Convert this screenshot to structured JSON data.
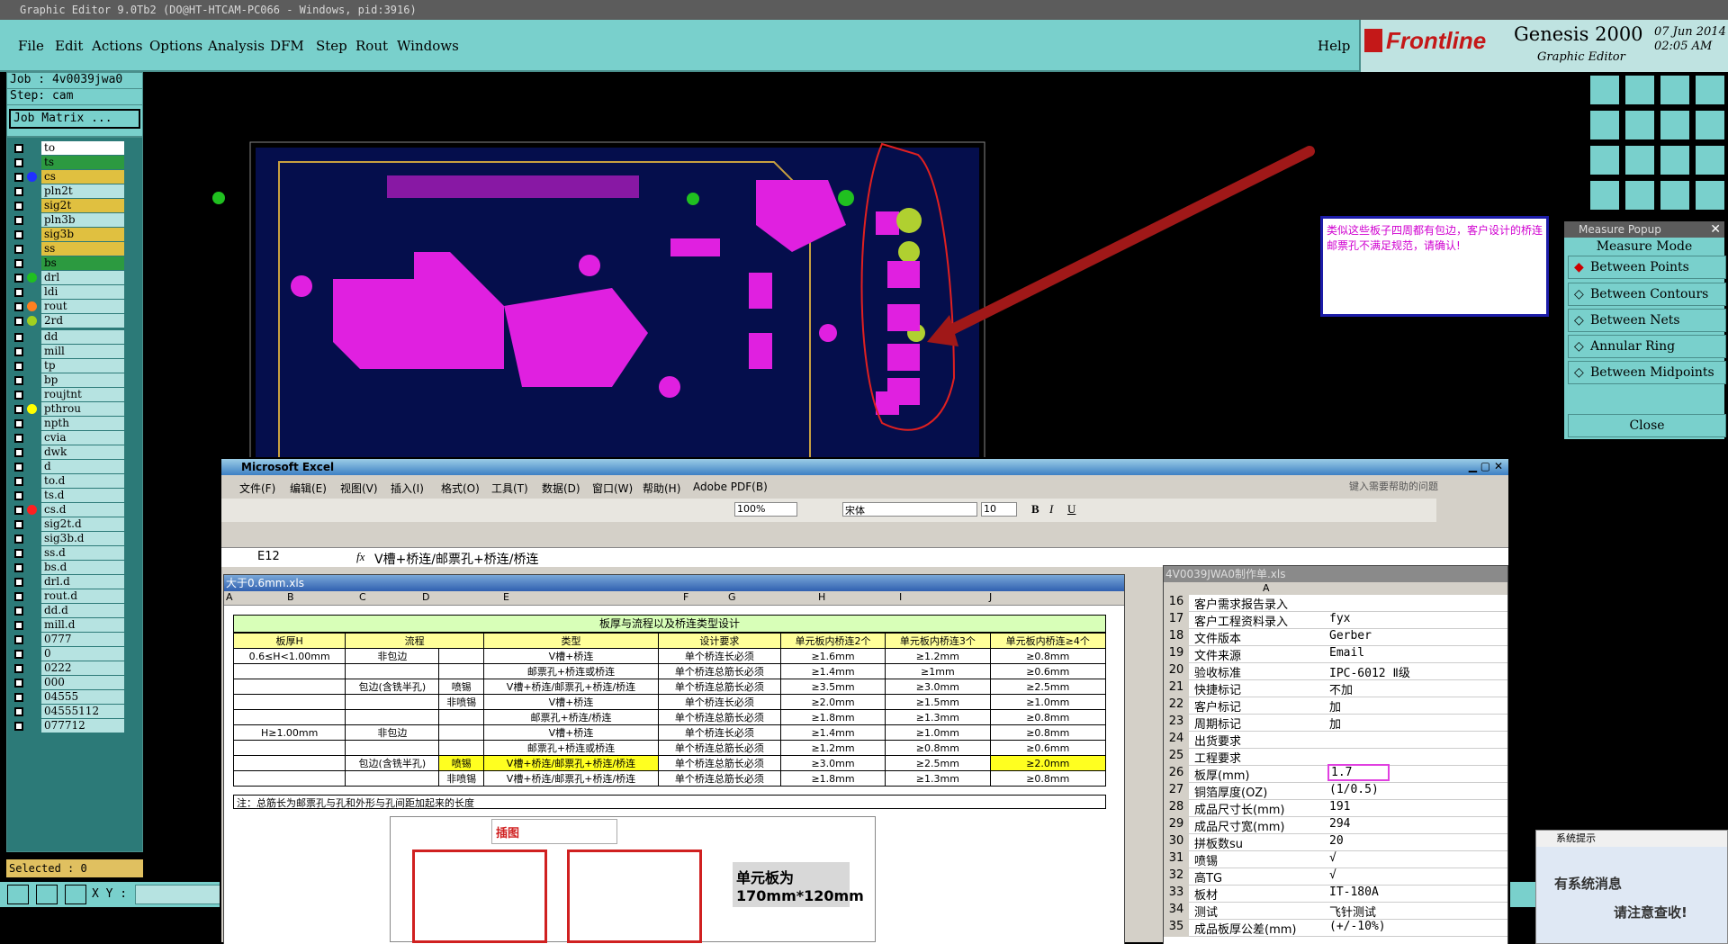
{
  "title": "Graphic Editor 9.0Tb2 (DO@HT-HTCAM-PC066 - Windows, pid:3916)",
  "menu": {
    "file": "File",
    "edit": "Edit",
    "actions": "Actions",
    "options": "Options",
    "analysis": "Analysis",
    "dfm": "DFM",
    "step": "Step",
    "rout": "Rout",
    "windows": "Windows",
    "help": "Help"
  },
  "brand": {
    "logo": "Frontline",
    "product": "Genesis 2000",
    "sub": "Graphic Editor",
    "date": "07 Jun 2014",
    "time": "02:05 AM"
  },
  "job": {
    "job": "Job : 4v0039jwa0",
    "step": "Step: cam",
    "matrix": "Job Matrix ..."
  },
  "layers": [
    "to",
    "ts",
    "cs",
    "pln2t",
    "sig2t",
    "pln3b",
    "sig3b",
    "ss",
    "bs",
    "drl",
    "ldi",
    "rout",
    "2rd",
    "dd",
    "mill",
    "tp",
    "bp",
    "roujtnt",
    "pthrou",
    "npth",
    "cvia",
    "dwk",
    "d",
    "to.d",
    "ts.d",
    "cs.d",
    "sig2t.d",
    "sig3b.d",
    "ss.d",
    "bs.d",
    "drl.d",
    "rout.d",
    "dd.d",
    "mill.d",
    "0777",
    "0",
    "0222",
    "000",
    "04555",
    "04555112",
    "077712"
  ],
  "selected": "Selected : 0",
  "xy": "X Y :",
  "note": "类似这些板子四周都有包边，客户设计的桥连邮票孔不满足规范，请确认!",
  "measure": {
    "title": "Measure Popup",
    "mode": "Measure Mode",
    "items": [
      "Between Points",
      "Between Contours",
      "Between Nets",
      "Annular Ring",
      "Between Midpoints"
    ],
    "close": "Close"
  },
  "excel": {
    "title": "Microsoft Excel",
    "menu": [
      "文件(F)",
      "编辑(E)",
      "视图(V)",
      "插入(I)",
      "格式(O)",
      "工具(T)",
      "数据(D)",
      "窗口(W)",
      "帮助(H)",
      "Adobe PDF(B)"
    ],
    "help_placeholder": "键入需要帮助的问题",
    "zoom": "100%",
    "font": "宋体",
    "size": "10",
    "cell": "E12",
    "formula": "V槽+桥连/邮票孔+桥连/桥连",
    "book1": "大于0.6mm.xls",
    "book2": "4V0039JWA0制作单.xls",
    "cols": [
      "A",
      "B",
      "C",
      "D",
      "E",
      "F",
      "G",
      "H",
      "I",
      "J"
    ],
    "table_title": "板厚与流程以及桥连类型设计",
    "headers": [
      "板厚H",
      "流程",
      "类型",
      "设计要求",
      "单元板内桥连2个",
      "单元板内桥连3个",
      "单元板内桥连≥4个"
    ],
    "rows": [
      [
        "0.6≤H<1.00mm",
        "非包边",
        "",
        "V槽+桥连",
        "单个桥连长必须",
        "≥1.6mm",
        "≥1.2mm",
        "≥0.8mm"
      ],
      [
        "",
        "",
        "",
        "邮票孔+桥连或桥连",
        "单个桥连总筋长必须",
        "≥1.4mm",
        "≥1mm",
        "≥0.6mm"
      ],
      [
        "",
        "包边(含铣半孔)",
        "喷锡",
        "V槽+桥连/邮票孔+桥连/桥连",
        "单个桥连总筋长必须",
        "≥3.5mm",
        "≥3.0mm",
        "≥2.5mm"
      ],
      [
        "",
        "",
        "非喷锡",
        "V槽+桥连",
        "单个桥连长必须",
        "≥2.0mm",
        "≥1.5mm",
        "≥1.0mm"
      ],
      [
        "",
        "",
        "",
        "邮票孔+桥连/桥连",
        "单个桥连总筋长必须",
        "≥1.8mm",
        "≥1.3mm",
        "≥0.8mm"
      ],
      [
        "H≥1.00mm",
        "非包边",
        "",
        "V槽+桥连",
        "单个桥连长必须",
        "≥1.4mm",
        "≥1.0mm",
        "≥0.8mm"
      ],
      [
        "",
        "",
        "",
        "邮票孔+桥连或桥连",
        "单个桥连总筋长必须",
        "≥1.2mm",
        "≥0.8mm",
        "≥0.6mm"
      ],
      [
        "",
        "包边(含铣半孔)",
        "喷锡",
        "V槽+桥连/邮票孔+桥连/桥连",
        "单个桥连总筋长必须",
        "≥3.0mm",
        "≥2.5mm",
        "≥2.0mm"
      ],
      [
        "",
        "",
        "非喷锡",
        "V槽+桥连/邮票孔+桥连/桥连",
        "单个桥连总筋长必须",
        "≥1.8mm",
        "≥1.3mm",
        "≥0.8mm"
      ]
    ],
    "footnote": "注：总筋长为邮票孔与孔和外形与孔间距加起来的长度",
    "insert": "插图",
    "unit": "单元板为 170mm*120mm",
    "sheet2_col": "A",
    "sheet2_rows": [
      [
        "16",
        "客户需求报告录入",
        ""
      ],
      [
        "17",
        "客户工程资料录入",
        "fyx"
      ],
      [
        "18",
        "文件版本",
        "Gerber"
      ],
      [
        "19",
        "文件来源",
        "Email"
      ],
      [
        "20",
        "验收标准",
        "IPC-6012 Ⅱ级"
      ],
      [
        "21",
        "快捷标记",
        "不加"
      ],
      [
        "22",
        "客户标记",
        "加"
      ],
      [
        "23",
        "周期标记",
        "加"
      ],
      [
        "24",
        "出货要求",
        ""
      ],
      [
        "25",
        "工程要求",
        ""
      ],
      [
        "26",
        "板厚(mm)",
        "1.7"
      ],
      [
        "27",
        "铜箔厚度(OZ)",
        "(1/0.5)"
      ],
      [
        "28",
        "成品尺寸长(mm)",
        "191"
      ],
      [
        "29",
        "成品尺寸宽(mm)",
        "294"
      ],
      [
        "30",
        "拼板数su",
        "20"
      ],
      [
        "31",
        "喷锡",
        "√"
      ],
      [
        "32",
        "高TG",
        "√"
      ],
      [
        "33",
        "板材",
        "IT-180A"
      ],
      [
        "34",
        "测试",
        "飞针测试"
      ],
      [
        "35",
        "成品板厚公差(mm)",
        "(+/-10%)"
      ]
    ]
  },
  "sysmsg": {
    "title": "系统提示",
    "line1": "有系统消息",
    "line2": "请注意查收!"
  }
}
